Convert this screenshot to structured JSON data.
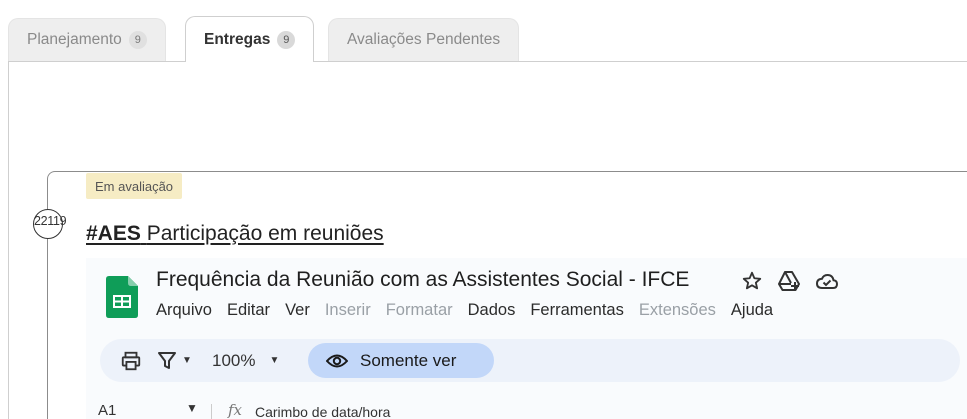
{
  "tabs": [
    {
      "label": "Planejamento",
      "count": "9"
    },
    {
      "label": "Entregas",
      "count": "9"
    },
    {
      "label": "Avaliações Pendentes"
    }
  ],
  "task": {
    "status": "Em avaliação",
    "id": "22119",
    "tag": "#AES",
    "title": "Participação em reuniões"
  },
  "sheet": {
    "doc_title": "Frequência da Reunião com as Assistentes Social - IFCE",
    "menu": [
      {
        "label": "Arquivo",
        "enabled": true
      },
      {
        "label": "Editar",
        "enabled": true
      },
      {
        "label": "Ver",
        "enabled": true
      },
      {
        "label": "Inserir",
        "enabled": false
      },
      {
        "label": "Formatar",
        "enabled": false
      },
      {
        "label": "Dados",
        "enabled": true
      },
      {
        "label": "Ferramentas",
        "enabled": true
      },
      {
        "label": "Extensões",
        "enabled": false
      },
      {
        "label": "Ajuda",
        "enabled": true
      }
    ],
    "zoom": "100%",
    "view_mode": "Somente ver",
    "cell_ref": "A1",
    "fx_label": "fx",
    "cell_content": "Carimbo de data/hora"
  },
  "colors": {
    "sheets_green": "#0f9d58",
    "badge_bg": "#f6ecc4",
    "toolbar_bg": "#edf2fa",
    "view_btn_bg": "#c2d7f9"
  }
}
